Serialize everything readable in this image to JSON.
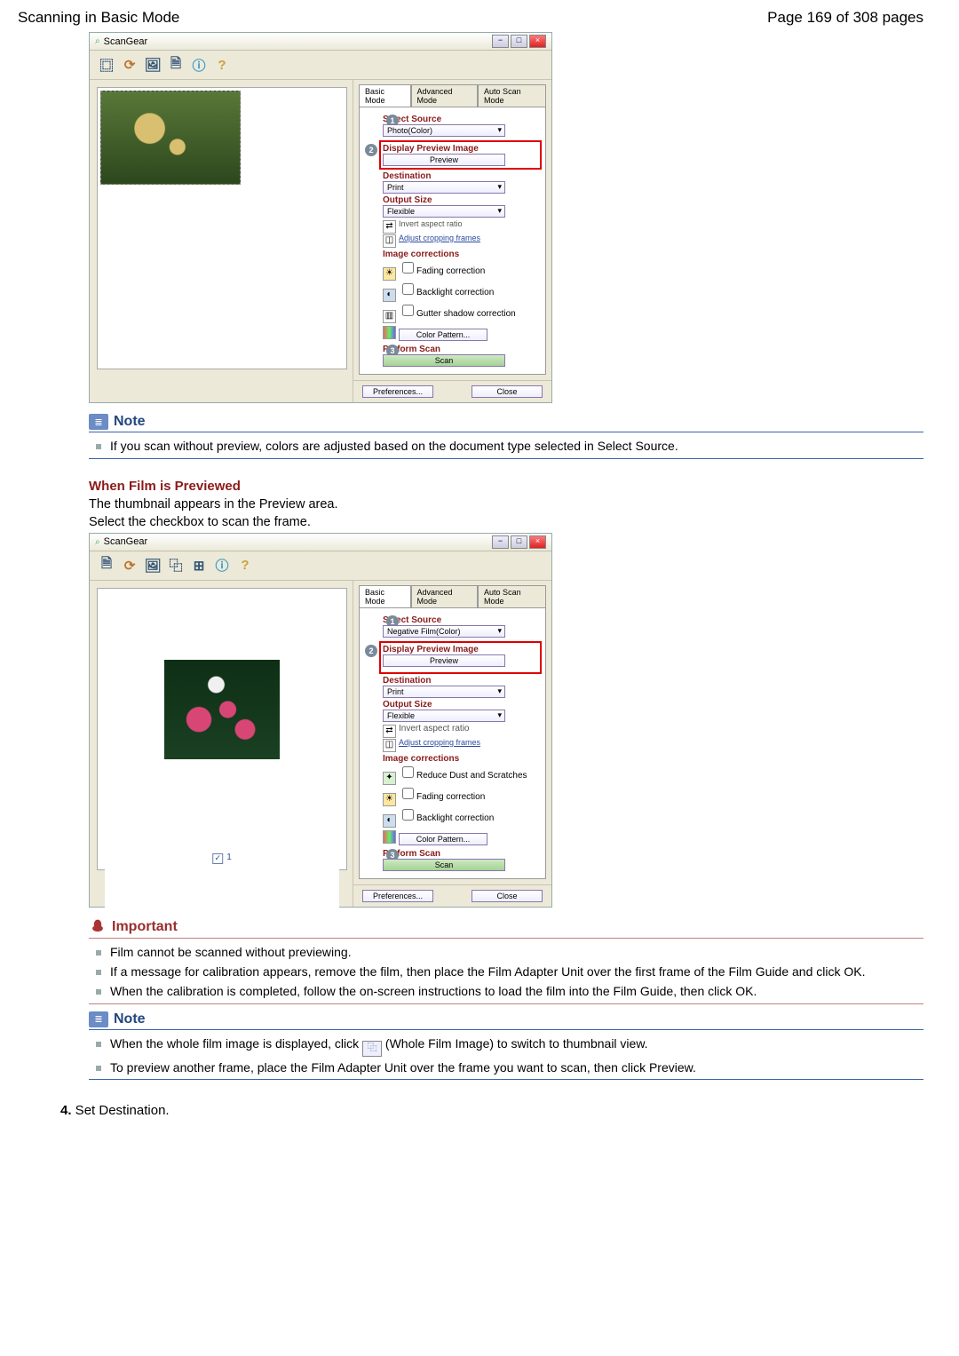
{
  "header": {
    "title": "Scanning in Basic Mode",
    "pageinfo": "Page 169 of 308 pages"
  },
  "sg": {
    "title": "ScanGear",
    "toolbar_icons": [
      "crop-icon",
      "rotate-icon",
      "thumb-icon",
      "copy-icon",
      "info-icon",
      "help-icon"
    ],
    "tabs": {
      "basic": "Basic Mode",
      "adv": "Advanced Mode",
      "auto": "Auto Scan Mode"
    },
    "steps": {
      "s1": "Select Source",
      "s2": "Display Preview Image",
      "s3": "Perform Scan"
    },
    "source1": "Photo(Color)",
    "source2": "Negative Film(Color)",
    "preview_btn": "Preview",
    "dest_hdr": "Destination",
    "dest_val": "Print",
    "out_hdr": "Output Size",
    "out_val": "Flexible",
    "invert": "Invert aspect ratio",
    "adjust": "Adjust cropping frames",
    "corr_hdr": "Image corrections",
    "corr1": "Fading correction",
    "corr2": "Backlight correction",
    "corr3": "Gutter shadow correction",
    "corr_dust": "Reduce Dust and Scratches",
    "colorpat": "Color Pattern...",
    "scan": "Scan",
    "pref": "Preferences...",
    "close": "Close",
    "frameno": "1"
  },
  "note1": {
    "hdr": "Note",
    "body": "If you scan without preview, colors are adjusted based on the document type selected in Select Source."
  },
  "film": {
    "hdr": "When Film is Previewed",
    "l1": "The thumbnail appears in the Preview area.",
    "l2": "Select the checkbox to scan the frame."
  },
  "important": {
    "hdr": "Important",
    "i1": "Film cannot be scanned without previewing.",
    "i2": "If a message for calibration appears, remove the film, then place the Film Adapter Unit over the first frame of the Film Guide and click OK.",
    "i3": "When the calibration is completed, follow the on-screen instructions to load the film into the Film Guide, then click OK."
  },
  "note2": {
    "hdr": "Note",
    "n1a": "When the whole film image is displayed, click ",
    "n1b": " (Whole Film Image) to switch to thumbnail view.",
    "n2": "To preview another frame, place the Film Adapter Unit over the frame you want to scan, then click Preview."
  },
  "step4": {
    "num": "4.",
    "txt": " Set Destination."
  }
}
